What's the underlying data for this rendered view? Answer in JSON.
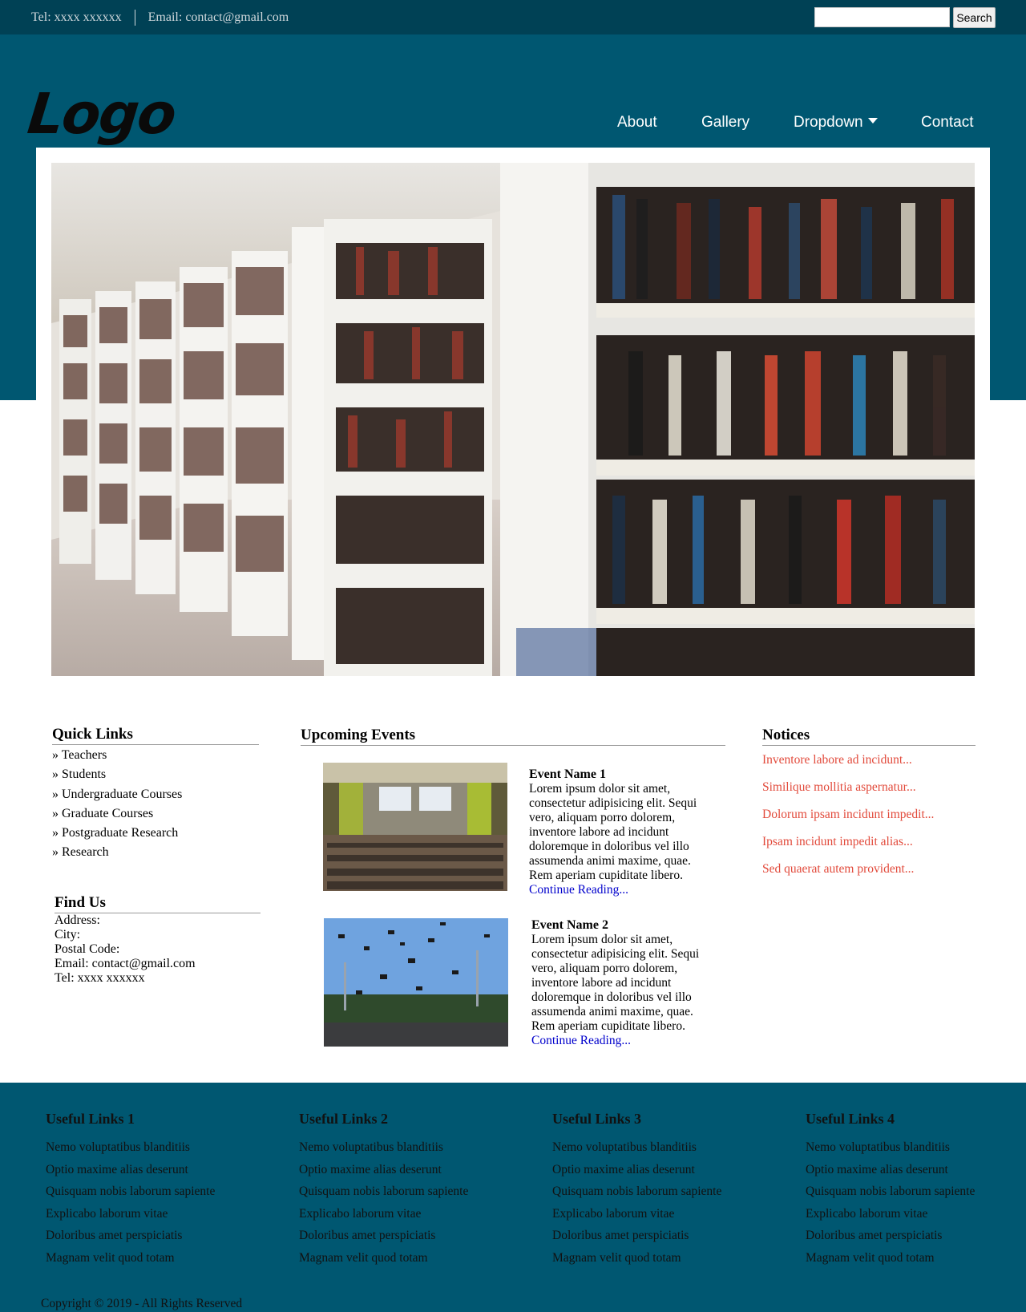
{
  "topbar": {
    "tel": "Tel: xxxx xxxxxx",
    "email": "Email: contact@gmail.com",
    "search_placeholder": "",
    "search_button": "Search"
  },
  "header": {
    "logo": "Logo",
    "nav": [
      "About",
      "Gallery",
      "Dropdown",
      "Contact"
    ]
  },
  "quick_links": {
    "title": "Quick Links",
    "items": [
      "» Teachers",
      "» Students",
      "» Undergraduate Courses",
      "» Graduate Courses",
      "» Postgraduate Research",
      "» Research"
    ]
  },
  "find_us": {
    "title": "Find Us",
    "lines": [
      "Address:",
      "City:",
      "Postal Code:",
      "Email: contact@gmail.com",
      "Tel: xxxx xxxxxx"
    ]
  },
  "events": {
    "title": "Upcoming Events",
    "items": [
      {
        "name": "Event Name 1",
        "body": "Lorem ipsum dolor sit amet, consectetur adipisicing elit. Sequi vero, aliquam porro dolorem, inventore labore ad incidunt doloremque in doloribus vel illo assumenda animi maxime, quae. Rem aperiam cupiditate libero.",
        "link": "Continue Reading..."
      },
      {
        "name": "Event Name 2",
        "body": "Lorem ipsum dolor sit amet, consectetur adipisicing elit. Sequi vero, aliquam porro dolorem, inventore labore ad incidunt doloremque in doloribus vel illo assumenda animi maxime, quae. Rem aperiam cupiditate libero.",
        "link": "Continue Reading..."
      }
    ]
  },
  "notices": {
    "title": "Notices",
    "items": [
      "Inventore labore ad incidunt...",
      "Similique mollitia aspernatur...",
      "Dolorum ipsam incidunt impedit...",
      "Ipsam incidunt impedit alias...",
      "Sed quaerat autem provident..."
    ]
  },
  "footer": {
    "columns": [
      {
        "title": "Useful Links 1",
        "links": [
          "Nemo voluptatibus blanditiis",
          "Optio maxime alias deserunt",
          "Quisquam nobis laborum sapiente",
          "Explicabo laborum vitae",
          "Doloribus amet perspiciatis",
          "Magnam velit quod totam"
        ]
      },
      {
        "title": "Useful Links 2",
        "links": [
          "Nemo voluptatibus blanditiis",
          "Optio maxime alias deserunt",
          "Quisquam nobis laborum sapiente",
          "Explicabo laborum vitae",
          "Doloribus amet perspiciatis",
          "Magnam velit quod totam"
        ]
      },
      {
        "title": "Useful Links 3",
        "links": [
          "Nemo voluptatibus blanditiis",
          "Optio maxime alias deserunt",
          "Quisquam nobis laborum sapiente",
          "Explicabo laborum vitae",
          "Doloribus amet perspiciatis",
          "Magnam velit quod totam"
        ]
      },
      {
        "title": "Useful Links 4",
        "links": [
          "Nemo voluptatibus blanditiis",
          "Optio maxime alias deserunt",
          "Quisquam nobis laborum sapiente",
          "Explicabo laborum vitae",
          "Doloribus amet perspiciatis",
          "Magnam velit quod totam"
        ]
      }
    ],
    "copyright": "Copyright © 2019 - All Rights Reserved"
  },
  "colors": {
    "topbar": "#004155",
    "header": "#005771",
    "notice_text": "#e24a3b",
    "link": "#0000cc"
  }
}
